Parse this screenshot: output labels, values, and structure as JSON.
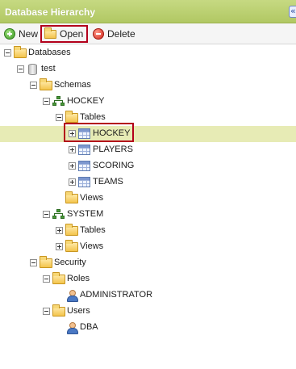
{
  "header": {
    "title": "Database Hierarchy",
    "collapse_glyph": "«"
  },
  "toolbar": {
    "new_label": "New",
    "open_label": "Open",
    "delete_label": "Delete"
  },
  "tree": {
    "databases": "Databases",
    "test": "test",
    "schemas": "Schemas",
    "schema_hockey": "HOCKEY",
    "tables_1": "Tables",
    "table_hockey": "HOCKEY",
    "table_players": "PLAYERS",
    "table_scoring": "SCORING",
    "table_teams": "TEAMS",
    "views_1": "Views",
    "schema_system": "SYSTEM",
    "tables_2": "Tables",
    "views_2": "Views",
    "security": "Security",
    "roles": "Roles",
    "administrator": "ADMINISTRATOR",
    "users": "Users",
    "dba": "DBA"
  },
  "colors": {
    "header": "#b9cf6e",
    "selected_row": "#e7ebb5",
    "highlight": "#b3001b"
  }
}
